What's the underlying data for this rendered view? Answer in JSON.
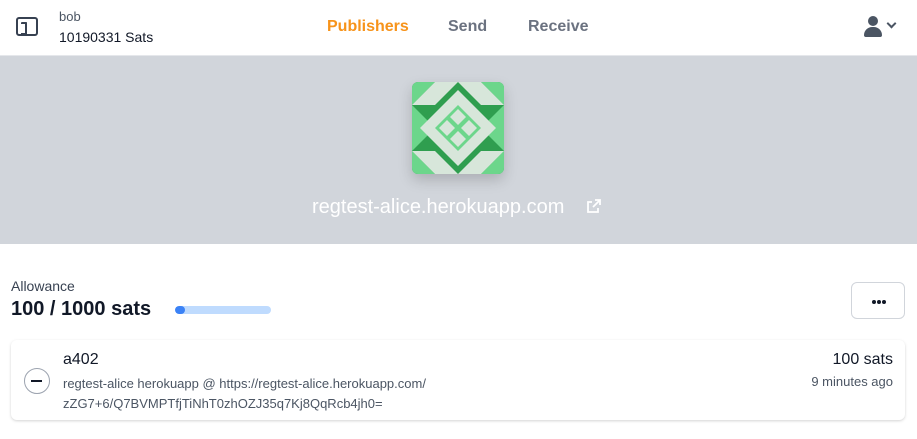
{
  "header": {
    "account_icon": "wallet-icon",
    "account_name": "bob",
    "balance": "10190331 Sats",
    "nav": {
      "publishers": "Publishers",
      "send": "Send",
      "receive": "Receive"
    },
    "active_nav": "publishers",
    "user_icon": "user-icon",
    "menu_icon": "chevron-down-icon",
    "accent_color": "#f7931a"
  },
  "publisher": {
    "avatar_icon": "identicon-quilt",
    "avatar_colors": [
      "#2f9e4f",
      "#6cd68b",
      "#d7e6da"
    ],
    "name": "regtest-alice.herokuapp.com",
    "link_icon": "external-link-icon"
  },
  "allowance": {
    "label": "Allowance",
    "value": "100 / 1000 sats",
    "usage_fraction": 0.1,
    "more_icon": "ellipsis-icon"
  },
  "payments": [
    {
      "icon": "minus-circle-icon",
      "title": "a402",
      "description": "regtest-alice herokuapp @ https://regtest-alice.herokuapp.com/ zZG7+6/Q7BVMPTfjTiNhT0zhOZJ35q7Kj8QqRcb4jh0=",
      "amount": "100 sats",
      "time": "9 minutes ago"
    }
  ]
}
